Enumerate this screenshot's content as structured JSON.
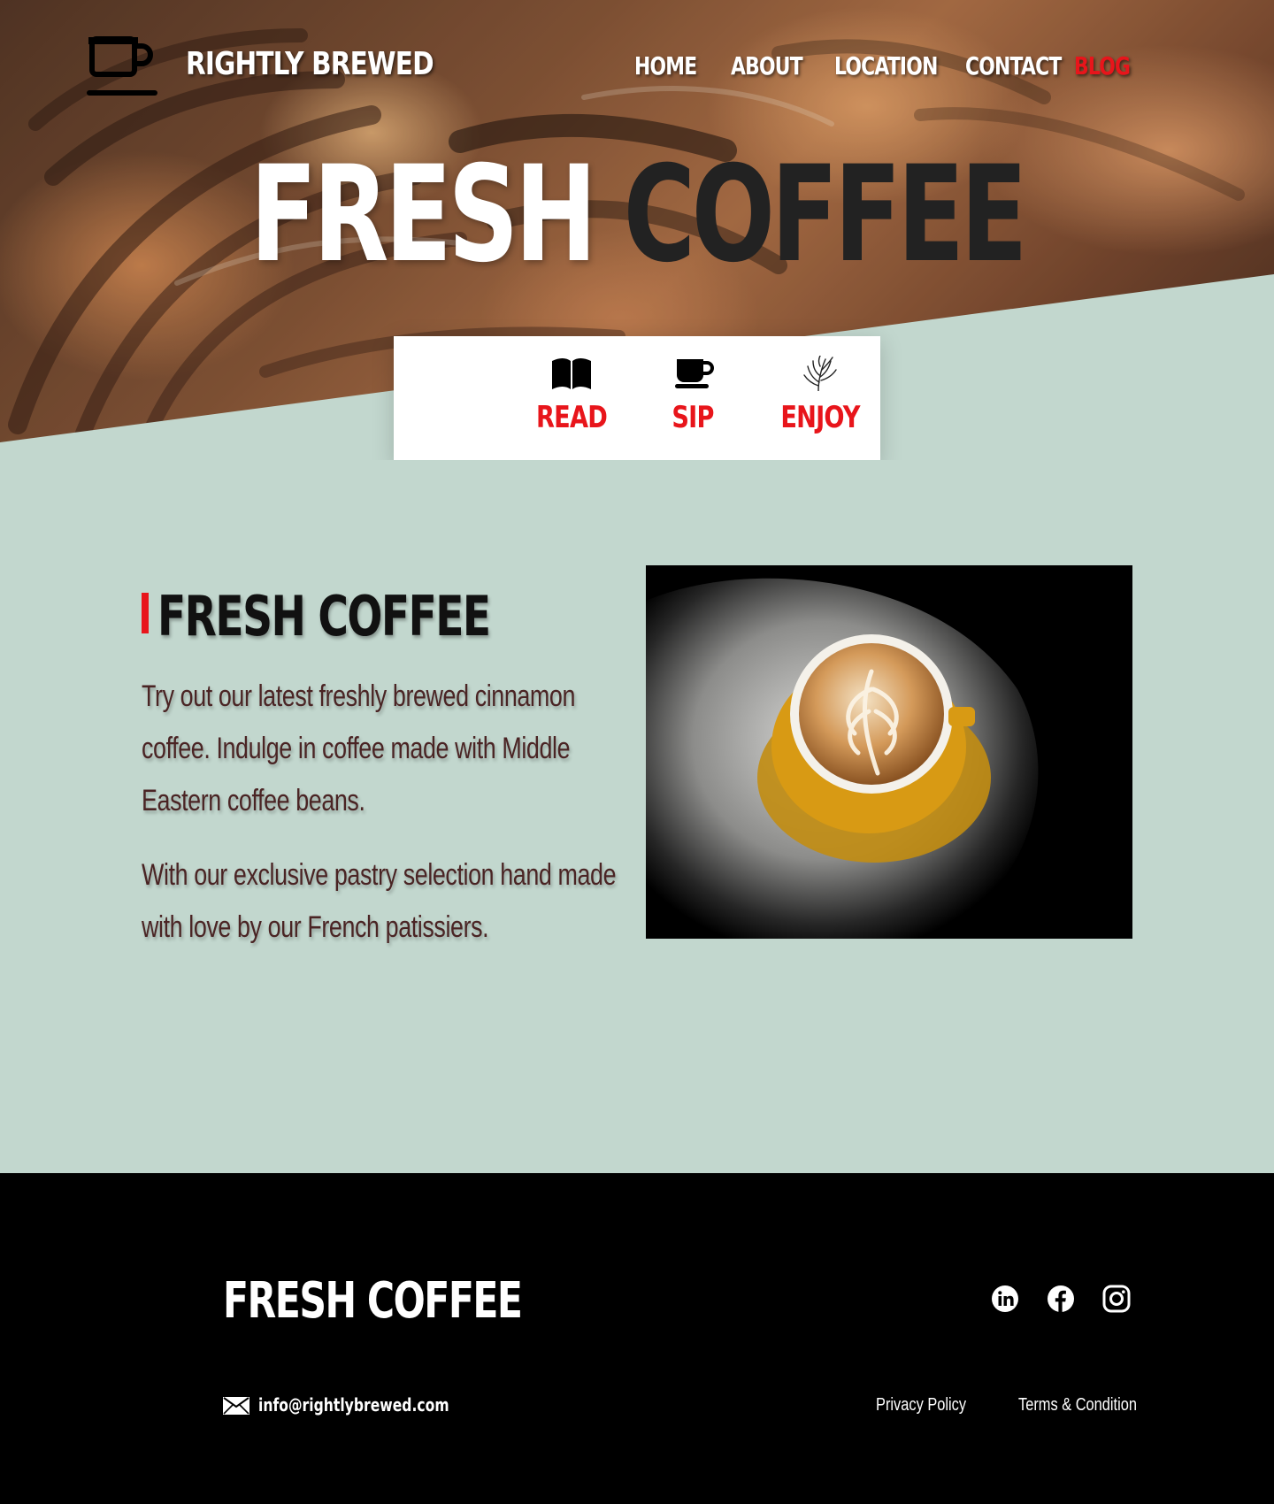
{
  "header": {
    "brand": "RIGHTLY BREWED",
    "logo_icon": "coffee-cup-icon",
    "nav": [
      {
        "label": "HOME"
      },
      {
        "label": "ABOUT"
      },
      {
        "label": "LOCATION"
      },
      {
        "label": "CONTACT"
      },
      {
        "label": "BLOG",
        "active": true
      }
    ]
  },
  "hero": {
    "title_word1": "FRESH",
    "title_word2": "COFFEE",
    "background_image": "croissants-photo"
  },
  "features": [
    {
      "label": "READ",
      "icon": "open-book-icon"
    },
    {
      "label": "SIP",
      "icon": "coffee-cup-icon"
    },
    {
      "label": "ENJOY",
      "icon": "leaf-sprig-icon"
    }
  ],
  "main": {
    "heading": "FRESH COFFEE",
    "paragraph1": "Try out our latest freshly brewed cinnamon coffee. Indulge in coffee made with Middle Eastern coffee beans.",
    "paragraph2": "With our exclusive pastry selection hand made with love by our French patissiers.",
    "image": "latte-art-cup-photo"
  },
  "footer": {
    "title": "FRESH COFFEE",
    "email": "info@rightlybrewed.com",
    "email_icon": "mail-icon",
    "social": [
      {
        "icon": "linkedin-icon"
      },
      {
        "icon": "facebook-icon"
      },
      {
        "icon": "instagram-icon"
      }
    ],
    "links": [
      {
        "label": "Privacy Policy"
      },
      {
        "label": "Terms & Condition"
      }
    ]
  },
  "colors": {
    "accent": "#e8151b",
    "mint_background": "#c2d7ce",
    "footer_background": "#000000",
    "dark_text": "#222222",
    "body_text": "#4a2424"
  }
}
